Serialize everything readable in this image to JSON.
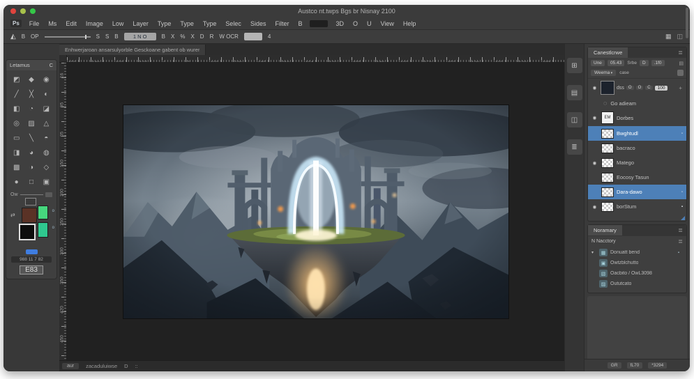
{
  "window": {
    "title": "Austco nt.twps Bgs br Nisnay 2100",
    "traffic": [
      {
        "name": "close",
        "color": "#e0443e"
      },
      {
        "name": "minimize",
        "color": "#a8c24b"
      },
      {
        "name": "zoom",
        "color": "#35c748"
      }
    ]
  },
  "menu": {
    "app_label": "Ps",
    "items": [
      "File",
      "Ms",
      "Edit",
      "Image",
      "Low",
      "Layer",
      "Type",
      "Type",
      "Type",
      "Selec",
      "Sides",
      "Filter",
      "B"
    ],
    "extras": [
      "3D",
      "O",
      "U",
      "View",
      "Help"
    ]
  },
  "options": {
    "b_label": "B",
    "op_label": "OP",
    "s1": "S",
    "s2": "S",
    "s3": "B",
    "field_value": "1 N O",
    "i1": "B",
    "i2": "X",
    "i3": "%",
    "i4": "X",
    "d_label": "D",
    "r_label": "R",
    "wocr_label": "W OCR",
    "end_label": "4"
  },
  "tab_bar": {
    "doc_title": "Enhwerjaroan ansarsulyorble Gesckoane gabent ob wurer"
  },
  "rulers": {
    "h": [
      "156",
      "148",
      "130",
      "137",
      "6",
      "7",
      "188",
      "690",
      "610",
      "918",
      "104",
      "106",
      "100",
      "148",
      "160",
      "150",
      "152",
      "188",
      "182",
      "132",
      "113"
    ],
    "v": [
      "16",
      "95",
      "05",
      "150",
      "200",
      "250",
      "300",
      "350",
      "420",
      "450"
    ]
  },
  "status": {
    "zoom_chip": "aur",
    "doc_text": "zacaduluiwse",
    "g1": "D",
    "g2": "::"
  },
  "tools_panel": {
    "header": "Letamus",
    "header_btn": "C",
    "tools": [
      "◩",
      "◆",
      "◉",
      "╱",
      "╳",
      "◐",
      "◧",
      "◔",
      "◪",
      "◎",
      "▨",
      "△",
      "▭",
      "╲",
      "◓",
      "◨",
      "◕",
      "◍",
      "▩",
      "◑",
      "◇",
      "●",
      "□",
      "▣"
    ],
    "mini_label": "Ow",
    "swatches": {
      "brown": "#5a3226",
      "green": "#46d77e",
      "black": "#0d0d0d",
      "teal": "#2fc98f"
    },
    "mini_button_blue": "#3f7de0",
    "chip_text": "988 11 7 82",
    "value_text": "E83"
  },
  "dock": {
    "buttons": [
      "⊞",
      "▤",
      "◫",
      "≣"
    ]
  },
  "layers_panel": {
    "tab": "Canestlcrwe",
    "filter": {
      "c1": "Une",
      "c2": "05.43",
      "label": "Srbe",
      "c3": "D",
      "c4": ".1f0"
    },
    "blend": {
      "value": "Weema",
      "lock_label": "case"
    },
    "control": {
      "label": "dss",
      "o1": "O",
      "o2": "O",
      "o3": "C",
      "value": "100"
    },
    "fx_label": "Go adieam",
    "group": {
      "thumb": "EM",
      "label": "Dorbes"
    },
    "layers": [
      {
        "label": "Bwghtudl",
        "selected": true,
        "eye": false,
        "badge": "▫"
      },
      {
        "label": "bacraco",
        "selected": false,
        "eye": false,
        "badge": ""
      },
      {
        "label": "Matego",
        "selected": false,
        "eye": true,
        "badge": ""
      },
      {
        "label": "Eocosy Tasun",
        "selected": false,
        "eye": false,
        "badge": ""
      },
      {
        "label": "Dara-dawo",
        "selected": true,
        "eye": false,
        "badge": "▫"
      },
      {
        "label": "borStum",
        "selected": false,
        "eye": true,
        "badge": "▪"
      }
    ]
  },
  "history_panel": {
    "tab": "Noramary",
    "header": "N Nacctory",
    "items": [
      {
        "icon": "▦",
        "label": "Donuatt bend",
        "expand": true,
        "right": "▪"
      },
      {
        "icon": "▣",
        "label": "Owtzblchutto",
        "expand": false,
        "right": ""
      },
      {
        "icon": "▧",
        "label": "Oacbito / OwL3098",
        "expand": false,
        "right": ""
      },
      {
        "icon": "▨",
        "label": "Oututcato",
        "expand": false,
        "right": ""
      }
    ]
  },
  "footer": {
    "buttons": [
      "GR",
      "fL70",
      "*3294"
    ]
  },
  "icons": {
    "eye": "◉",
    "panel_menu": "≣",
    "expander": "▾",
    "workspace": "▦",
    "grid": "◫"
  },
  "colors": {
    "selection_blue": "#4d80b8",
    "panel_bg": "#3f3f3f",
    "canvas_bg": "#212121"
  }
}
